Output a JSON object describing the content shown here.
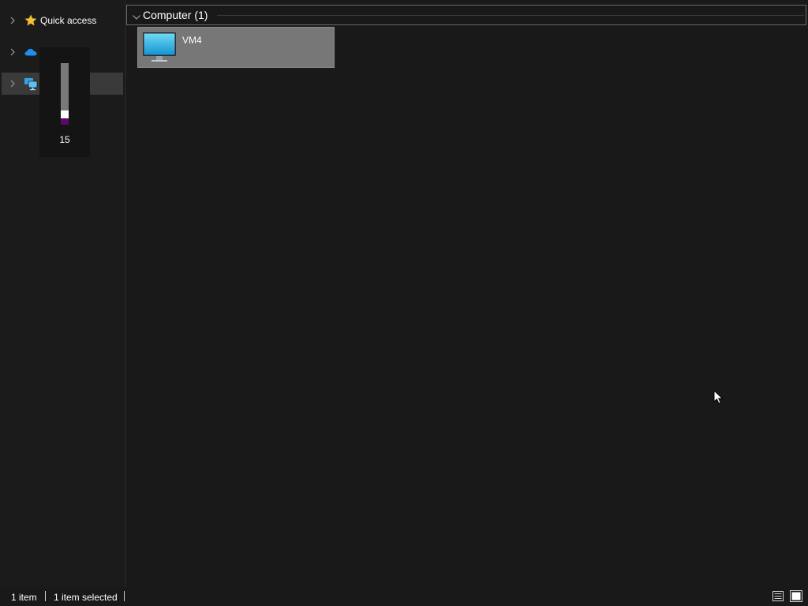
{
  "nav": {
    "items": [
      {
        "label": "Quick access",
        "icon": "star-icon"
      },
      {
        "label": "",
        "icon": "onedrive-cloud-icon"
      },
      {
        "label": "",
        "icon": "network-icon"
      }
    ]
  },
  "volume_flyout": {
    "value": "15",
    "level": 0.15
  },
  "content": {
    "group_title": "Computer (1)",
    "items": [
      {
        "name": "VM4",
        "icon": "computer-monitor-icon"
      }
    ]
  },
  "statusbar": {
    "item_count": "1 item",
    "selection": "1 item selected"
  },
  "colors": {
    "background": "#191919",
    "selected_item": "#777777",
    "volume_fill": "#5a0a6a",
    "star": "#f2c12e",
    "cloud": "#1f8ef1"
  }
}
